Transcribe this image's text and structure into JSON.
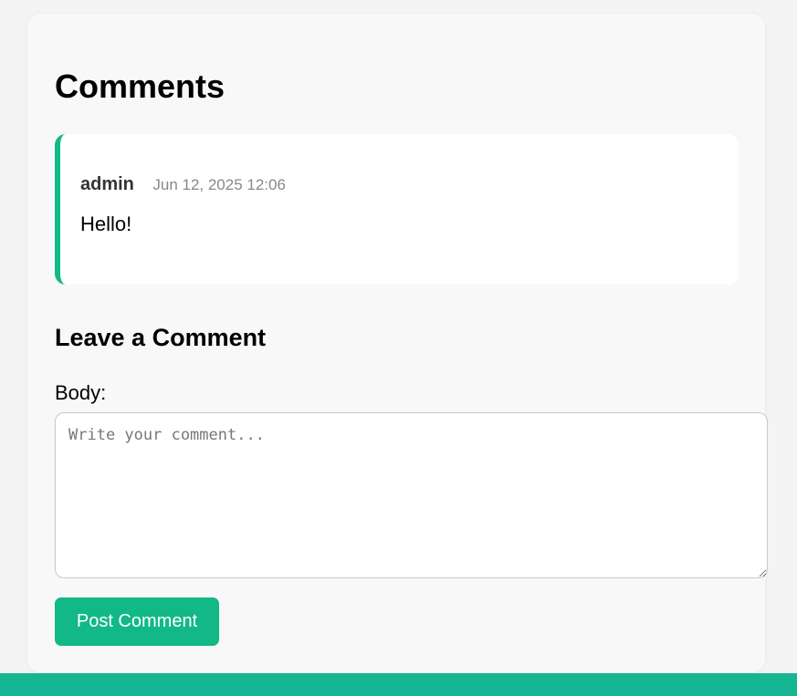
{
  "comments_section": {
    "title": "Comments",
    "items": [
      {
        "author": "admin",
        "timestamp": "Jun 12, 2025 12:06",
        "body": "Hello!"
      }
    ]
  },
  "form": {
    "title": "Leave a Comment",
    "body_label": "Body:",
    "body_placeholder": "Write your comment...",
    "body_value": "",
    "submit_label": "Post Comment"
  },
  "colors": {
    "accent": "#12b886",
    "footer": "#16b594",
    "card_background": "#f8f8f8",
    "comment_background": "#ffffff"
  }
}
